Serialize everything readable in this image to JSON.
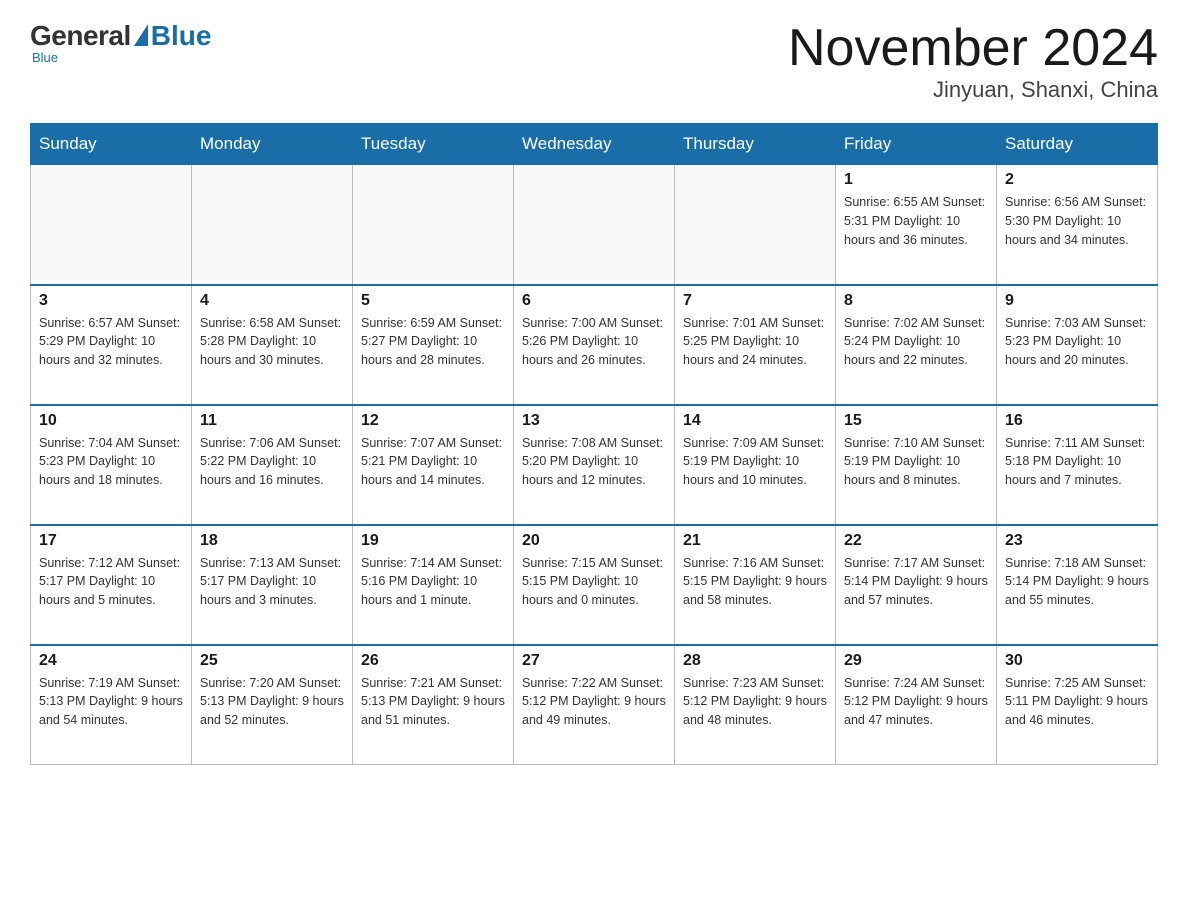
{
  "logo": {
    "general": "General",
    "blue": "Blue",
    "tagline": "Blue"
  },
  "header": {
    "month_year": "November 2024",
    "location": "Jinyuan, Shanxi, China"
  },
  "weekdays": [
    "Sunday",
    "Monday",
    "Tuesday",
    "Wednesday",
    "Thursday",
    "Friday",
    "Saturday"
  ],
  "weeks": [
    [
      {
        "day": "",
        "info": ""
      },
      {
        "day": "",
        "info": ""
      },
      {
        "day": "",
        "info": ""
      },
      {
        "day": "",
        "info": ""
      },
      {
        "day": "",
        "info": ""
      },
      {
        "day": "1",
        "info": "Sunrise: 6:55 AM\nSunset: 5:31 PM\nDaylight: 10 hours and 36 minutes."
      },
      {
        "day": "2",
        "info": "Sunrise: 6:56 AM\nSunset: 5:30 PM\nDaylight: 10 hours and 34 minutes."
      }
    ],
    [
      {
        "day": "3",
        "info": "Sunrise: 6:57 AM\nSunset: 5:29 PM\nDaylight: 10 hours and 32 minutes."
      },
      {
        "day": "4",
        "info": "Sunrise: 6:58 AM\nSunset: 5:28 PM\nDaylight: 10 hours and 30 minutes."
      },
      {
        "day": "5",
        "info": "Sunrise: 6:59 AM\nSunset: 5:27 PM\nDaylight: 10 hours and 28 minutes."
      },
      {
        "day": "6",
        "info": "Sunrise: 7:00 AM\nSunset: 5:26 PM\nDaylight: 10 hours and 26 minutes."
      },
      {
        "day": "7",
        "info": "Sunrise: 7:01 AM\nSunset: 5:25 PM\nDaylight: 10 hours and 24 minutes."
      },
      {
        "day": "8",
        "info": "Sunrise: 7:02 AM\nSunset: 5:24 PM\nDaylight: 10 hours and 22 minutes."
      },
      {
        "day": "9",
        "info": "Sunrise: 7:03 AM\nSunset: 5:23 PM\nDaylight: 10 hours and 20 minutes."
      }
    ],
    [
      {
        "day": "10",
        "info": "Sunrise: 7:04 AM\nSunset: 5:23 PM\nDaylight: 10 hours and 18 minutes."
      },
      {
        "day": "11",
        "info": "Sunrise: 7:06 AM\nSunset: 5:22 PM\nDaylight: 10 hours and 16 minutes."
      },
      {
        "day": "12",
        "info": "Sunrise: 7:07 AM\nSunset: 5:21 PM\nDaylight: 10 hours and 14 minutes."
      },
      {
        "day": "13",
        "info": "Sunrise: 7:08 AM\nSunset: 5:20 PM\nDaylight: 10 hours and 12 minutes."
      },
      {
        "day": "14",
        "info": "Sunrise: 7:09 AM\nSunset: 5:19 PM\nDaylight: 10 hours and 10 minutes."
      },
      {
        "day": "15",
        "info": "Sunrise: 7:10 AM\nSunset: 5:19 PM\nDaylight: 10 hours and 8 minutes."
      },
      {
        "day": "16",
        "info": "Sunrise: 7:11 AM\nSunset: 5:18 PM\nDaylight: 10 hours and 7 minutes."
      }
    ],
    [
      {
        "day": "17",
        "info": "Sunrise: 7:12 AM\nSunset: 5:17 PM\nDaylight: 10 hours and 5 minutes."
      },
      {
        "day": "18",
        "info": "Sunrise: 7:13 AM\nSunset: 5:17 PM\nDaylight: 10 hours and 3 minutes."
      },
      {
        "day": "19",
        "info": "Sunrise: 7:14 AM\nSunset: 5:16 PM\nDaylight: 10 hours and 1 minute."
      },
      {
        "day": "20",
        "info": "Sunrise: 7:15 AM\nSunset: 5:15 PM\nDaylight: 10 hours and 0 minutes."
      },
      {
        "day": "21",
        "info": "Sunrise: 7:16 AM\nSunset: 5:15 PM\nDaylight: 9 hours and 58 minutes."
      },
      {
        "day": "22",
        "info": "Sunrise: 7:17 AM\nSunset: 5:14 PM\nDaylight: 9 hours and 57 minutes."
      },
      {
        "day": "23",
        "info": "Sunrise: 7:18 AM\nSunset: 5:14 PM\nDaylight: 9 hours and 55 minutes."
      }
    ],
    [
      {
        "day": "24",
        "info": "Sunrise: 7:19 AM\nSunset: 5:13 PM\nDaylight: 9 hours and 54 minutes."
      },
      {
        "day": "25",
        "info": "Sunrise: 7:20 AM\nSunset: 5:13 PM\nDaylight: 9 hours and 52 minutes."
      },
      {
        "day": "26",
        "info": "Sunrise: 7:21 AM\nSunset: 5:13 PM\nDaylight: 9 hours and 51 minutes."
      },
      {
        "day": "27",
        "info": "Sunrise: 7:22 AM\nSunset: 5:12 PM\nDaylight: 9 hours and 49 minutes."
      },
      {
        "day": "28",
        "info": "Sunrise: 7:23 AM\nSunset: 5:12 PM\nDaylight: 9 hours and 48 minutes."
      },
      {
        "day": "29",
        "info": "Sunrise: 7:24 AM\nSunset: 5:12 PM\nDaylight: 9 hours and 47 minutes."
      },
      {
        "day": "30",
        "info": "Sunrise: 7:25 AM\nSunset: 5:11 PM\nDaylight: 9 hours and 46 minutes."
      }
    ]
  ]
}
